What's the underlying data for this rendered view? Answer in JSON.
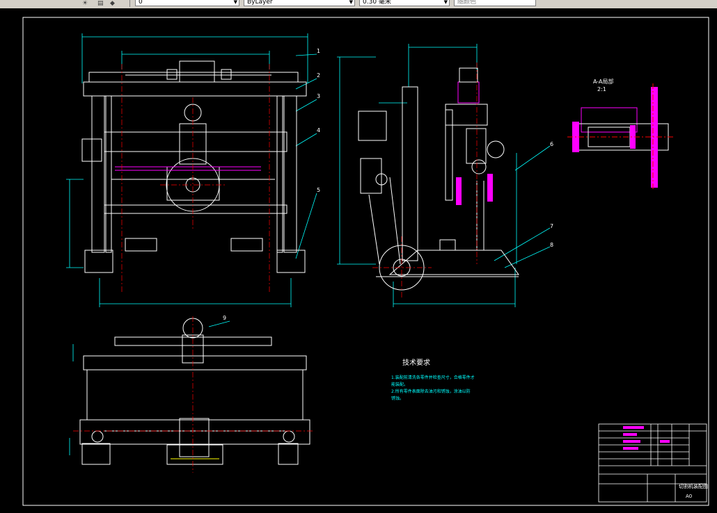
{
  "toolbar": {
    "layer_value": "0",
    "linetype_value": "ByLayer",
    "lineweight_value": "0.30 毫米",
    "plotstyle_value": "随颜色"
  },
  "drawing": {
    "tech_title": "技术要求",
    "tech_notes": [
      "1.装配前清洗各零件并检查尺寸，合格零件才",
      "能装配。",
      "2.所有零件表面除去油污和锈蚀，涂油以防",
      "锈蚀。"
    ],
    "section_label": "A-A局部",
    "section_scale": "2:1",
    "balloons": [
      "1",
      "2",
      "3",
      "4",
      "5",
      "6",
      "7",
      "8",
      "9"
    ],
    "title_block": {
      "drawing_name": "切割机装配图",
      "sheet_size": "A0"
    }
  },
  "colors": {
    "background": "#000000",
    "outline": "#ffffff",
    "centerline": "#ff0000",
    "dimension": "#00ffff",
    "hatch": "#ff00ff",
    "text": "#ffffff",
    "toolbar": "#d4d0c8"
  },
  "icons": [
    "layer-icon",
    "color-icon",
    "dropdown-icon"
  ]
}
